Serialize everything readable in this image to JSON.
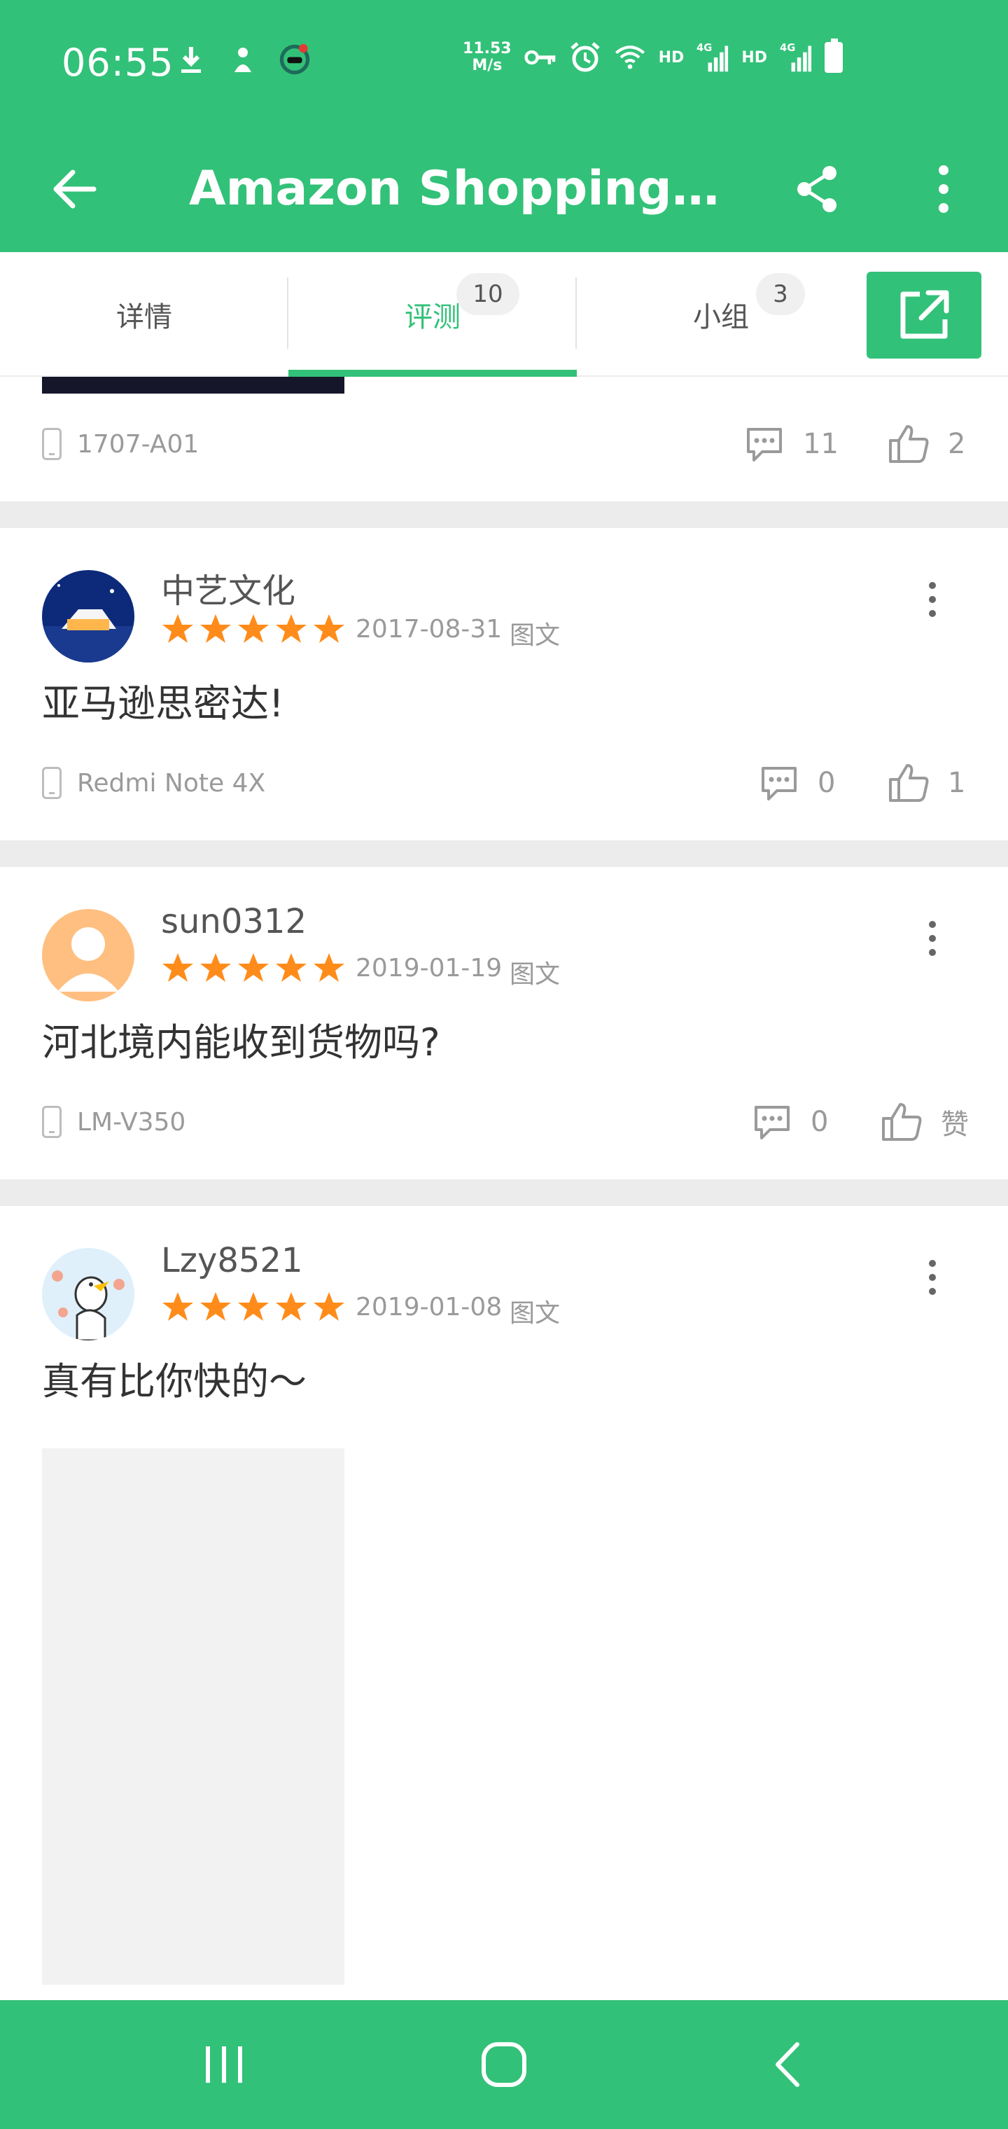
{
  "status_bar": {
    "time": "06:55",
    "net_speed_value": "11.53",
    "net_speed_unit": "M/s",
    "hd1": "HD",
    "net1": "4G",
    "hd2": "HD",
    "net2": "4G"
  },
  "toolbar": {
    "title": "Amazon Shopping - S…"
  },
  "tabs": [
    {
      "label": "详情",
      "badge": ""
    },
    {
      "label": "评测",
      "badge": "10"
    },
    {
      "label": "小组",
      "badge": "3"
    }
  ],
  "colors": {
    "brand": "#32c178",
    "star": "#ff8c1a",
    "divider": "#ececec"
  },
  "prev_post": {
    "device": "1707-A01",
    "comments": "11",
    "likes": "2"
  },
  "reviews": [
    {
      "username": "中艺文化",
      "rating": 5,
      "date": "2017-08-31",
      "post_type": "图文",
      "text": "亚马逊思密达!",
      "device": "Redmi Note 4X",
      "comments": "0",
      "likes": "1"
    },
    {
      "username": "sun0312",
      "rating": 5,
      "date": "2019-01-19",
      "post_type": "图文",
      "text": "河北境内能收到货物吗?",
      "device": "LM-V350",
      "comments": "0",
      "likes": "赞"
    },
    {
      "username": "Lzy8521",
      "rating": 5,
      "date": "2019-01-08",
      "post_type": "图文",
      "text": "真有比你快的～"
    }
  ]
}
